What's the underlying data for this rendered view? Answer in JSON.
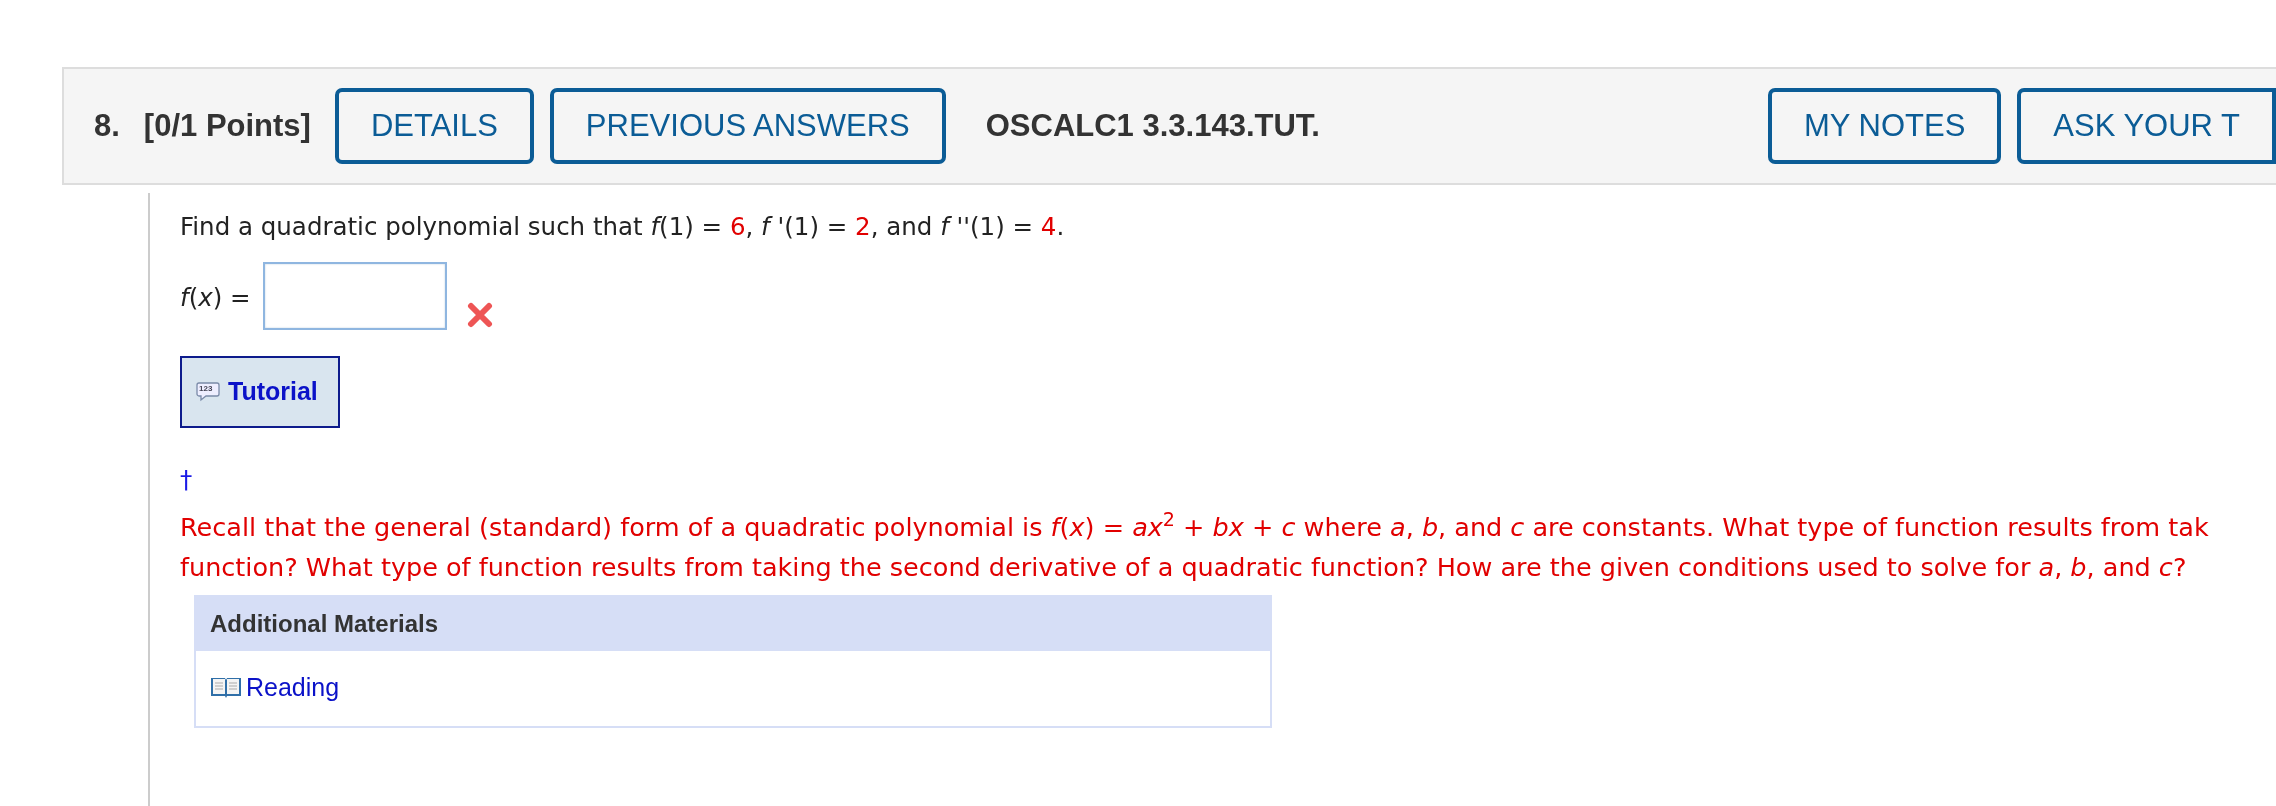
{
  "header": {
    "number": "8.",
    "points": "[0/1 Points]",
    "buttons": [
      {
        "label": "DETAILS"
      },
      {
        "label": "PREVIOUS ANSWERS"
      }
    ],
    "code": "OSCALC1 3.3.143.TUT.",
    "right_buttons": [
      {
        "label": "MY NOTES"
      },
      {
        "label": "ASK YOUR T"
      }
    ]
  },
  "question": [
    {
      "kind": "text",
      "text": "Find a quadratic polynomial such that *f*(1) = "
    },
    {
      "kind": "given",
      "text": "6"
    },
    {
      "kind": "text",
      "text": ", *f* '(1) = "
    },
    {
      "kind": "given",
      "text": "2"
    },
    {
      "kind": "text",
      "text": ", and *f* ''(1) = "
    },
    {
      "kind": "given",
      "text": "4"
    },
    {
      "kind": "text",
      "text": "."
    }
  ],
  "answer": {
    "label": "*f*(*x*) =",
    "correct": false
  },
  "tutorial": {
    "label": "Tutorial",
    "icon_text": "123"
  },
  "dagger": "†",
  "hint_lines": [
    "Recall that the general (standard) form of a quadratic polynomial is *f*(*x*) = *ax*$^{2}$ + *bx* + *c* where *a*, *b*, and *c* are constants. What type of function results from tak",
    "function? What type of function results from taking the second derivative of a quadratic function? How are the given conditions used to solve for *a*, *b*, and *c*?"
  ],
  "additional": {
    "title": "Additional Materials",
    "links": [
      {
        "label": "Reading"
      }
    ]
  }
}
